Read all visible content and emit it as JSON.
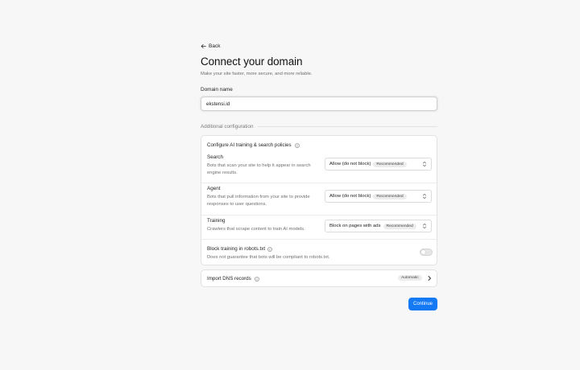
{
  "nav": {
    "back_label": "Back"
  },
  "header": {
    "title": "Connect your domain",
    "subtitle": "Make your site faster, more secure, and more reliable."
  },
  "domain": {
    "label": "Domain name",
    "value": "ekstensi.id"
  },
  "additional": {
    "section_label": "Additional configuration"
  },
  "ai_policies": {
    "title": "Configure AI training & search policies",
    "items": [
      {
        "name": "Search",
        "description": "Bots that scan your site to help it appear in search engine results.",
        "selected": "Allow (do not block)",
        "badge": "Recommended"
      },
      {
        "name": "Agent",
        "description": "Bots that pull information from your site to provide responses to user questions.",
        "selected": "Allow (do not block)",
        "badge": "Recommended"
      },
      {
        "name": "Training",
        "description": "Crawlers that scrape content to train AI models.",
        "selected": "Block on pages with ads",
        "badge": "Recommended"
      }
    ],
    "robots": {
      "name": "Block training in robots.txt",
      "description": "Does not guarantee that bots will be compliant to robots.txt.",
      "enabled": false
    }
  },
  "dns": {
    "label": "Import DNS records",
    "badge": "Automatic"
  },
  "actions": {
    "continue_label": "Continue"
  },
  "colors": {
    "primary": "#1479f5",
    "background": "#f7f7f7"
  }
}
